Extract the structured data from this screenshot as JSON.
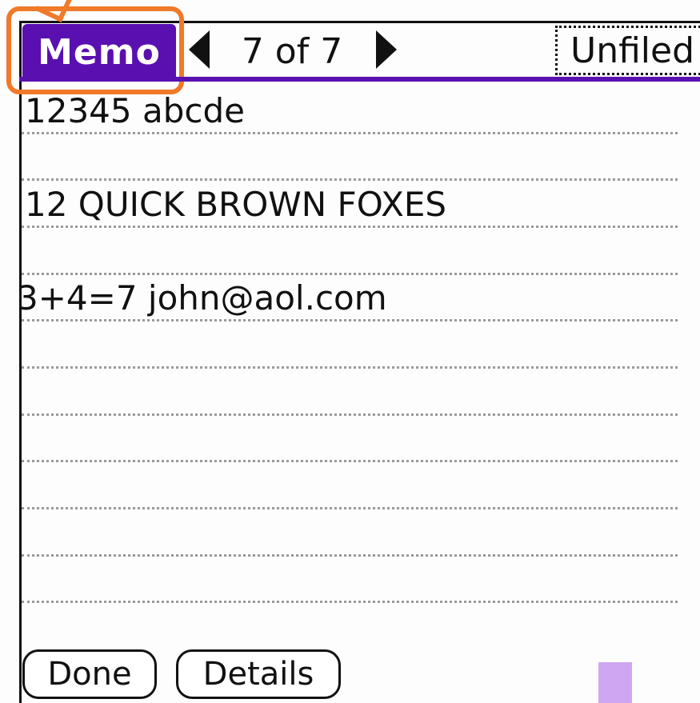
{
  "title_bar": {
    "app_title": "Memo",
    "page_counter": "7 of 7",
    "category": "Unfiled"
  },
  "memo": {
    "lines": [
      "12345 abcde",
      "",
      "12 QUICK BROWN FOXES",
      "",
      "3+4=7 john@aol.com",
      "",
      "",
      "",
      "",
      "",
      ""
    ]
  },
  "buttons": {
    "done_label": "Done",
    "details_label": "Details"
  },
  "icons": {
    "prev": "left-arrow-icon",
    "next": "right-arrow-icon"
  },
  "colors": {
    "accent": "#5a10b0",
    "highlight": "#f07a2a",
    "indicator": "#cfa6f2"
  }
}
